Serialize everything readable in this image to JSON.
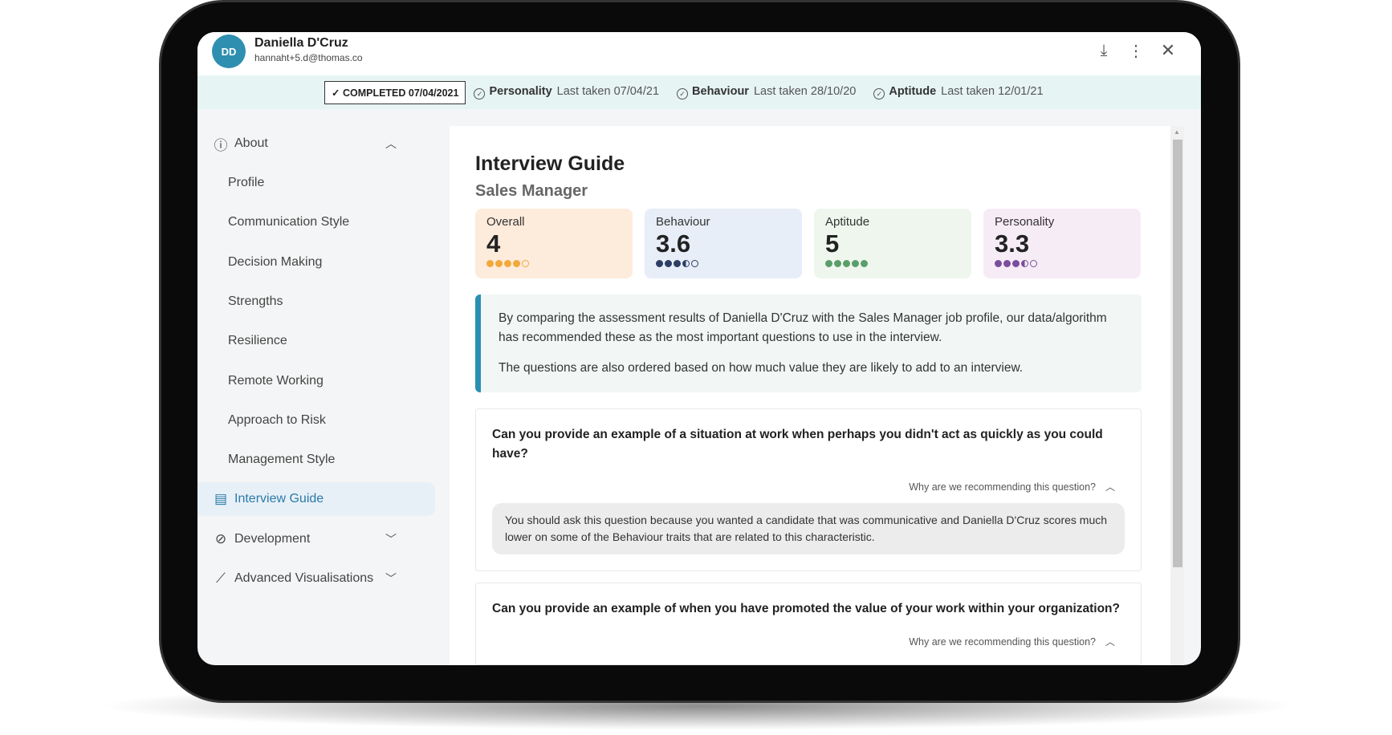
{
  "user": {
    "initials": "DD",
    "name": "Daniella D'Cruz",
    "email": "hannaht+5.d@thomas.co"
  },
  "header_icons": [
    "download-icon",
    "more-vert-icon",
    "close-icon"
  ],
  "status": {
    "completed": "COMPLETED 07/04/2021",
    "items": [
      {
        "name": "Personality",
        "last": "Last taken 07/04/21"
      },
      {
        "name": "Behaviour",
        "last": "Last taken 28/10/20"
      },
      {
        "name": "Aptitude",
        "last": "Last taken 12/01/21"
      }
    ]
  },
  "sidebar": {
    "about": "About",
    "items": [
      "Profile",
      "Communication Style",
      "Decision Making",
      "Strengths",
      "Resilience",
      "Remote Working",
      "Approach to Risk",
      "Management Style"
    ],
    "interview_guide": "Interview Guide",
    "development": "Development",
    "advanced": "Advanced Visualisations"
  },
  "main": {
    "title": "Interview Guide",
    "subtitle": "Sales Manager",
    "scores": [
      {
        "label": "Overall",
        "value": "4",
        "rating": 4,
        "color": "#f2a93b",
        "bg": "#fdebdc"
      },
      {
        "label": "Behaviour",
        "value": "3.6",
        "rating": 3.6,
        "color": "#2c3e64",
        "bg": "#e7eef8"
      },
      {
        "label": "Aptitude",
        "value": "5",
        "rating": 5,
        "color": "#5a9e6a",
        "bg": "#eef6ee"
      },
      {
        "label": "Personality",
        "value": "3.3",
        "rating": 3.3,
        "color": "#7b4e9c",
        "bg": "#f6ecf6"
      }
    ],
    "info": [
      "By comparing the assessment results of Daniella D'Cruz with the Sales Manager job profile, our data/algorithm has recommended these as the most important questions to use in the interview.",
      "The questions are also ordered based on how much value they are likely to add to an interview."
    ],
    "questions": [
      {
        "text": "Can you provide an example of a situation at work when perhaps you didn't act as quickly as you could have?",
        "why": "Why are we recommending this question?",
        "reason": "You should ask this question because you wanted a candidate that was communicative and Daniella D'Cruz scores much lower on some of the Behaviour traits that are related to this characteristic."
      },
      {
        "text": "Can you provide an example of when you have promoted the value of your work within your organization?",
        "why": "Why are we recommending this question?"
      }
    ]
  }
}
